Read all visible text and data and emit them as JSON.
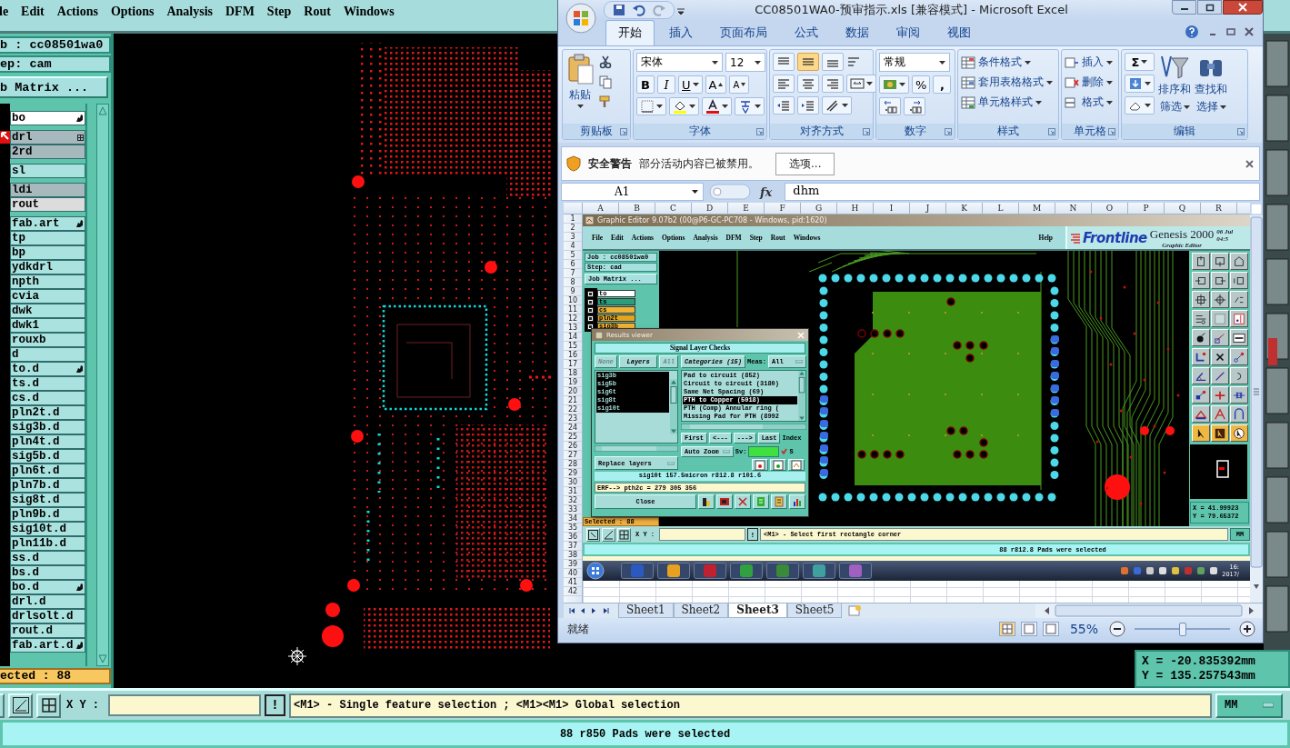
{
  "genesis": {
    "menu": [
      "le",
      "Edit",
      "Actions",
      "Options",
      "Analysis",
      "DFM",
      "Step",
      "Rout",
      "Windows"
    ],
    "job": "b : cc08501wa0",
    "step": "ep: cam",
    "job_matrix": "b Matrix ...",
    "layer_groups": [
      [
        {
          "name": "bo",
          "color": "#ffffff",
          "kind": "hand",
          "active": false
        }
      ],
      [
        {
          "name": "drl",
          "color": "#a7b9bd",
          "kind": "grid",
          "active": true
        },
        {
          "name": "2rd",
          "color": "#a7b9bd",
          "kind": "plain",
          "active": false
        }
      ],
      [
        {
          "name": "sl",
          "color": "#a9e2de",
          "kind": "plain",
          "active": false
        }
      ],
      [
        {
          "name": "ldi",
          "color": "#a7b9bd",
          "kind": "plain",
          "active": false
        },
        {
          "name": "rout",
          "color": "#dcdcdc",
          "kind": "plain",
          "active": false
        }
      ],
      [
        {
          "name": "fab.art",
          "color": "#a9e2de",
          "kind": "hand",
          "active": false
        },
        {
          "name": "tp",
          "color": "#a9e2de",
          "kind": "plain",
          "active": false
        },
        {
          "name": "bp",
          "color": "#a9e2de",
          "kind": "plain",
          "active": false
        },
        {
          "name": "ydkdrl",
          "color": "#a9e2de",
          "kind": "plain",
          "active": false
        },
        {
          "name": "npth",
          "color": "#a9e2de",
          "kind": "plain",
          "active": false
        },
        {
          "name": "cvia",
          "color": "#a9e2de",
          "kind": "plain",
          "active": false
        },
        {
          "name": "dwk",
          "color": "#a9e2de",
          "kind": "plain",
          "active": false
        },
        {
          "name": "dwk1",
          "color": "#a9e2de",
          "kind": "plain",
          "active": false
        },
        {
          "name": "rouxb",
          "color": "#a9e2de",
          "kind": "plain",
          "active": false
        },
        {
          "name": "d",
          "color": "#a9e2de",
          "kind": "plain",
          "active": false
        },
        {
          "name": "to.d",
          "color": "#a9e2de",
          "kind": "hand",
          "active": false
        },
        {
          "name": "ts.d",
          "color": "#a9e2de",
          "kind": "plain",
          "active": false
        },
        {
          "name": "cs.d",
          "color": "#a9e2de",
          "kind": "plain",
          "active": false
        },
        {
          "name": "pln2t.d",
          "color": "#a9e2de",
          "kind": "plain",
          "active": false
        },
        {
          "name": "sig3b.d",
          "color": "#a9e2de",
          "kind": "plain",
          "active": false
        },
        {
          "name": "pln4t.d",
          "color": "#a9e2de",
          "kind": "plain",
          "active": false
        },
        {
          "name": "sig5b.d",
          "color": "#a9e2de",
          "kind": "plain",
          "active": false
        },
        {
          "name": "pln6t.d",
          "color": "#a9e2de",
          "kind": "plain",
          "active": false
        },
        {
          "name": "pln7b.d",
          "color": "#a9e2de",
          "kind": "plain",
          "active": false
        },
        {
          "name": "sig8t.d",
          "color": "#a9e2de",
          "kind": "plain",
          "active": false
        },
        {
          "name": "pln9b.d",
          "color": "#a9e2de",
          "kind": "plain",
          "active": false
        },
        {
          "name": "sig10t.d",
          "color": "#a9e2de",
          "kind": "plain",
          "active": false
        },
        {
          "name": "pln11b.d",
          "color": "#a9e2de",
          "kind": "plain",
          "active": false
        },
        {
          "name": "ss.d",
          "color": "#a9e2de",
          "kind": "plain",
          "active": false
        },
        {
          "name": "bs.d",
          "color": "#a9e2de",
          "kind": "plain",
          "active": false
        },
        {
          "name": "bo.d",
          "color": "#a9e2de",
          "kind": "hand",
          "active": false
        },
        {
          "name": "drl.d",
          "color": "#a9e2de",
          "kind": "plain",
          "active": false
        },
        {
          "name": "drlsolt.d",
          "color": "#a9e2de",
          "kind": "plain",
          "active": false
        },
        {
          "name": "rout.d",
          "color": "#a9e2de",
          "kind": "plain",
          "active": false
        },
        {
          "name": "fab.art.d",
          "color": "#a9e2de",
          "kind": "hand",
          "active": false
        }
      ]
    ],
    "selected_count": "ected : 88",
    "coords": [
      "X = -20.835392mm",
      "Y = 135.257543mm"
    ],
    "xy_label": "X Y :",
    "alert": "!",
    "prompt": "<M1> - Single feature selection ; <M1><M1> Global selection",
    "units": "MM",
    "status": "88 r850 Pads were selected"
  },
  "excel": {
    "title": "CC08501WA0-预审指示.xls  [兼容模式] - Microsoft Excel",
    "tabs": [
      {
        "label": "开始",
        "selected": true
      },
      {
        "label": "插入",
        "selected": false
      },
      {
        "label": "页面布局",
        "selected": false
      },
      {
        "label": "公式",
        "selected": false
      },
      {
        "label": "数据",
        "selected": false
      },
      {
        "label": "审阅",
        "selected": false
      },
      {
        "label": "视图",
        "selected": false
      }
    ],
    "ribbon": {
      "clipboard": {
        "paste": "粘贴",
        "label": "剪贴板"
      },
      "font": {
        "name": "宋体",
        "size": "12",
        "bold": "B",
        "italic": "I",
        "underline": "U",
        "grow": "A",
        "shrink": "A",
        "label": "字体"
      },
      "alignment": {
        "label": "对齐方式"
      },
      "number": {
        "format": "常规",
        "percent": "%",
        "comma": ",",
        "label": "数字"
      },
      "styles": {
        "items": [
          "条件格式",
          "套用表格格式",
          "单元格样式"
        ],
        "label": "样式"
      },
      "cells": {
        "items": [
          "插入",
          "删除",
          "格式"
        ],
        "label": "单元格"
      },
      "editing": {
        "sum": "Σ",
        "sort": [
          "排序和",
          "筛选"
        ],
        "find": [
          "查找和",
          "选择"
        ],
        "label": "编辑"
      }
    },
    "warning": {
      "title": "安全警告",
      "text": "部分活动内容已被禁用。",
      "button": "选项..."
    },
    "formula": {
      "cell": "A1",
      "fx": "fx",
      "value": "dhm"
    },
    "columns": [
      "A",
      "B",
      "C",
      "D",
      "E",
      "F",
      "G",
      "H",
      "I",
      "J",
      "K",
      "L",
      "M",
      "N",
      "O",
      "P",
      "Q",
      "R"
    ],
    "rows": [
      "1",
      "2",
      "3",
      "4",
      "5",
      "6",
      "7",
      "8",
      "9",
      "10",
      "11",
      "12",
      "13",
      "14",
      "15",
      "16",
      "17",
      "18",
      "19",
      "20",
      "21",
      "22",
      "23",
      "24",
      "25",
      "26",
      "27",
      "28",
      "29",
      "30",
      "31",
      "32",
      "33",
      "34",
      "35",
      "36",
      "37",
      "38",
      "39",
      "40",
      "41",
      "42"
    ],
    "sheets": [
      {
        "label": "Sheet1",
        "selected": false
      },
      {
        "label": "Sheet2",
        "selected": false
      },
      {
        "label": "Sheet3",
        "selected": true
      },
      {
        "label": "Sheet5",
        "selected": false
      }
    ],
    "status": "就绪",
    "zoom": "55%",
    "zoom_slider": {
      "level": 0.5
    }
  },
  "inner": {
    "title": "Graphic Editor 9.07b2 (00@P6-GC-PC708 - Windows, pid:1620)",
    "menu": [
      "File",
      "Edit",
      "Actions",
      "Options",
      "Analysis",
      "DFM",
      "Step",
      "Rout",
      "Windows"
    ],
    "help": "Help",
    "brand": "Frontline",
    "product": "Genesis 2000",
    "date": "06 Jul",
    "time": "04:5",
    "subtitle": "Graphic Editor",
    "job": "Job : cc08501wa0",
    "step": "Step: cad",
    "job_matrix": "Job Matrix ...",
    "layers": [
      {
        "name": "to",
        "color": "#ffffff"
      },
      {
        "name": "ts",
        "color": "#2a9d7c"
      },
      {
        "name": "cs",
        "color": "#f2b232"
      },
      {
        "name": "pln2t",
        "color": "#e6a41c"
      },
      {
        "name": "sig3b",
        "color": "#f2b232"
      }
    ],
    "selected_count": "Selected : 88",
    "coords": [
      "X = 41.99923",
      "Y = 79.65372"
    ],
    "xy_label": "X Y :",
    "alert": "!",
    "prompt": "<M1> - Select first rectangle corner",
    "units": "MM",
    "status": "88 r812.8 Pads were selected",
    "clock": [
      "16:",
      "2017/"
    ],
    "results": {
      "title": "Results viewer",
      "heading": "Signal Layer Checks",
      "filters": [
        {
          "label": "None",
          "disabled": true
        },
        {
          "label": "Layers",
          "disabled": false
        },
        {
          "label": "All",
          "disabled": true
        }
      ],
      "categories_label": "Categories (15)",
      "meas_label": "Meas:",
      "meas_value": "All",
      "layers": [
        {
          "name": "sig3b",
          "selected": true
        },
        {
          "name": "sig5b",
          "selected": true
        },
        {
          "name": "sig6t",
          "selected": true
        },
        {
          "name": "sig8t",
          "selected": true
        },
        {
          "name": "sig10t",
          "selected": true
        }
      ],
      "categories": [
        {
          "name": "Pad to circuit (852)",
          "selected": false
        },
        {
          "name": "Circuit to circuit (3180)",
          "selected": false
        },
        {
          "name": "Same Net Spacing (69)",
          "selected": false
        },
        {
          "name": "PTH to Copper (5018)",
          "selected": true
        },
        {
          "name": "PTH (Comp) Annular ring (",
          "selected": false
        },
        {
          "name": "Missing Pad for PTH (8992",
          "selected": false
        }
      ],
      "nav": [
        "First",
        "<---",
        "--->",
        "Last",
        "Index"
      ],
      "zoom_mode": "Auto Zoom",
      "sv_label": "Sv:",
      "show": {
        "label": "S",
        "checked": true
      },
      "replace": "Replace layers",
      "info": "sig10t 157.5micron r812.8 r101.6",
      "erf": "ERF--> pth2c = 279 305 356",
      "close": "Close"
    }
  }
}
